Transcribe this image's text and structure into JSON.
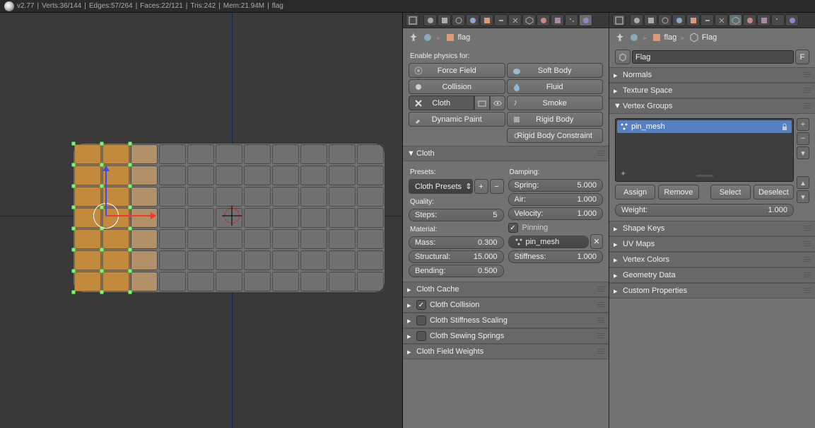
{
  "topbar": {
    "version": "v2.77",
    "verts": "Verts:36/144",
    "edges": "Edges:57/264",
    "faces": "Faces:22/121",
    "tris": "Tris:242",
    "mem": "Mem:21.94M",
    "name": "flag"
  },
  "left": {
    "breadcrumb_obj": "flag",
    "enable_label": "Enable physics for:",
    "buttons": {
      "force": "Force Field",
      "soft": "Soft Body",
      "collision": "Collision",
      "fluid": "Fluid",
      "cloth": "Cloth",
      "smoke": "Smoke",
      "dyn": "Dynamic Paint",
      "rigid": "Rigid Body",
      "rigidc": "Rigid Body Constraint"
    },
    "cloth": {
      "header": "Cloth",
      "presets_label": "Presets:",
      "presets_btn": "Cloth Presets",
      "quality_label": "Quality:",
      "steps_label": "Steps:",
      "steps": "5",
      "material_label": "Material:",
      "mass_label": "Mass:",
      "mass": "0.300",
      "struct_label": "Structural:",
      "struct": "15.000",
      "bend_label": "Bending:",
      "bend": "0.500",
      "damp_label": "Damping:",
      "spring_label": "Spring:",
      "spring": "5.000",
      "air_label": "Air:",
      "air": "1.000",
      "vel_label": "Velocity:",
      "vel": "1.000",
      "pin_label": "Pinning",
      "pin_group": "pin_mesh",
      "stiff_label": "Stiffness:",
      "stiff": "1.000"
    },
    "panels": [
      "Cloth Cache",
      "Cloth Collision",
      "Cloth Stiffness Scaling",
      "Cloth Sewing Springs",
      "Cloth Field Weights"
    ]
  },
  "right": {
    "breadcrumb_obj": "flag",
    "breadcrumb_data": "Flag",
    "name_field": "Flag",
    "f_btn": "F",
    "panels_top": [
      "Normals",
      "Texture Space"
    ],
    "vg_header": "Vertex Groups",
    "vg_item": "pin_mesh",
    "assign": "Assign",
    "remove": "Remove",
    "select": "Select",
    "deselect": "Deselect",
    "weight_label": "Weight:",
    "weight": "1.000",
    "panels_bot": [
      "Shape Keys",
      "UV Maps",
      "Vertex Colors",
      "Geometry Data",
      "Custom Properties"
    ]
  }
}
